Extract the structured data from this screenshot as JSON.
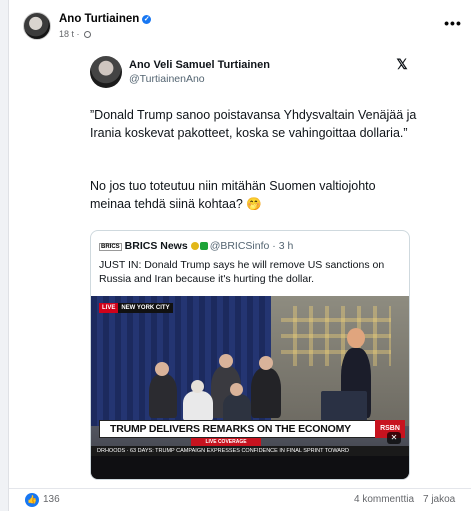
{
  "post": {
    "author": "Ano Turtiainen",
    "time": "18 t",
    "more_label": "•••"
  },
  "tweet": {
    "name": "Ano Veli Samuel Turtiainen",
    "handle": "@TurtiainenAno",
    "text1": "”Donald Trump sanoo poistavansa Yhdysvaltain Venäjää ja Irania koskevat pakotteet, koska se vahingoittaa dollaria.”",
    "text2": "No jos tuo toteutuu niin mitähän Suomen valtiojohto meinaa tehdä siinä kohtaa? 🤭",
    "x_logo": "𝕏"
  },
  "quote": {
    "logo": "BRICS",
    "name": "BRICS News",
    "handle": "@BRICSinfo",
    "time": "3 h",
    "text": "JUST IN: Donald Trump says he will remove US sanctions on Russia and Iran because it's hurting the dollar.",
    "video": {
      "live_label": "LIVE",
      "location": "NEW YORK CITY",
      "lower_third": "TRUMP DELIVERS REMARKS ON THE ECONOMY",
      "rsbn": "RSBN",
      "live_coverage": "LIVE COVERAGE",
      "ticker": "DRHOODS · 63 DAYS: TRUMP CAMPAIGN EXPRESSES CONFIDENCE IN FINAL SPRINT TOWARD"
    }
  },
  "footer": {
    "likes": "136",
    "comments": "4 kommenttia",
    "shares": "7 jakoa"
  },
  "colors": {
    "accent": "#1877f2",
    "live_red": "#d0021b"
  }
}
